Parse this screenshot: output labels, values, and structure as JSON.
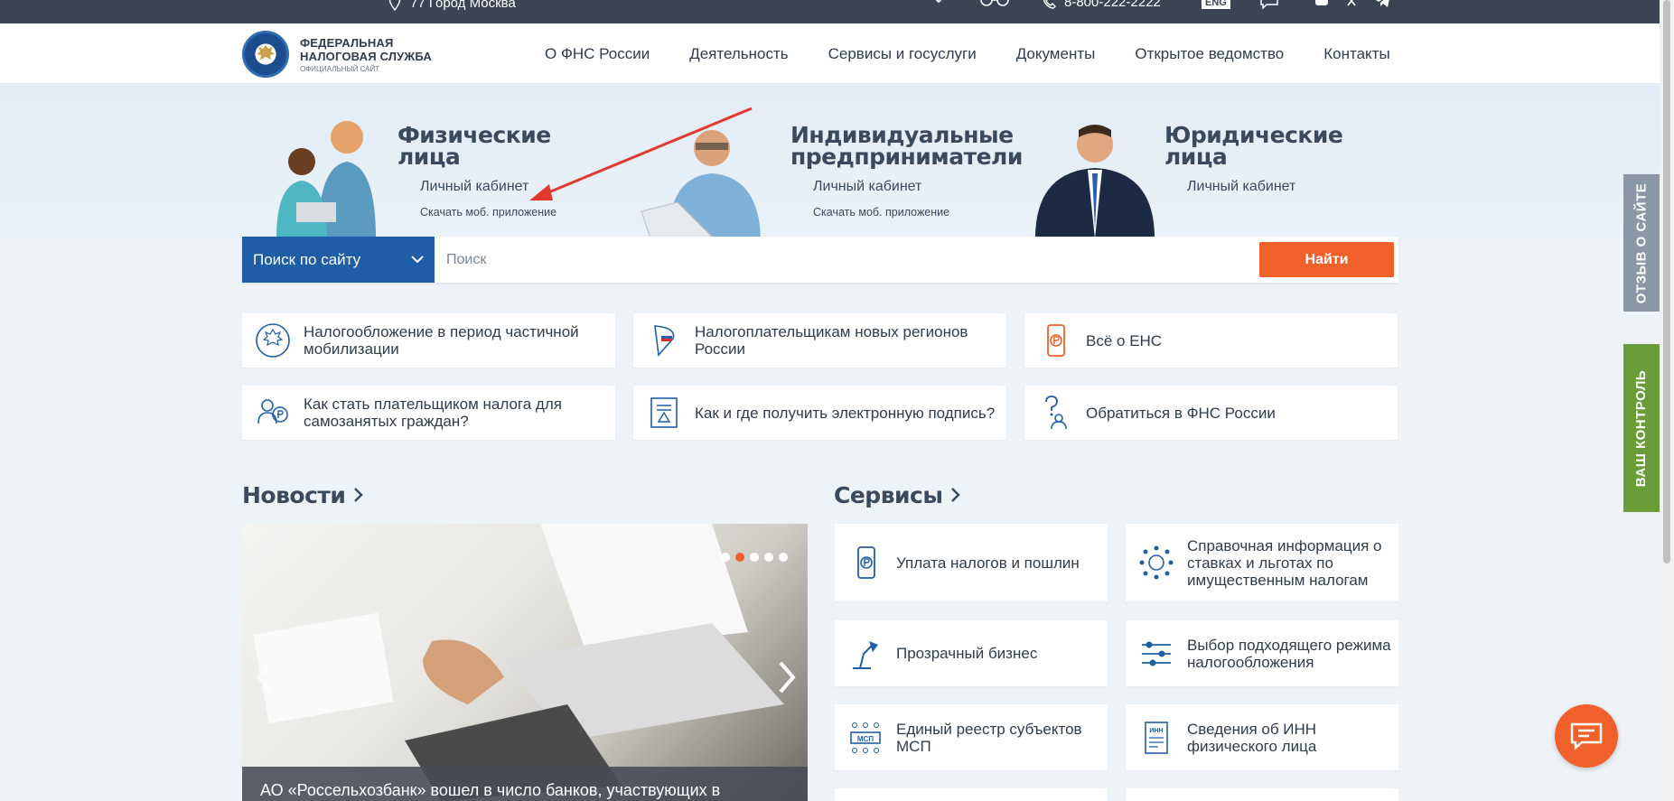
{
  "topbar": {
    "city": "77 Город Москва",
    "phone": "8-800-222-2222",
    "lang": "ENG"
  },
  "header": {
    "logo_line1": "ФЕДЕРАЛЬНАЯ",
    "logo_line2": "НАЛОГОВАЯ СЛУЖБА",
    "logo_line3": "ОФИЦИАЛЬНЫЙ САЙТ",
    "nav": [
      "О ФНС России",
      "Деятельность",
      "Сервисы и госуслуги",
      "Документы",
      "Открытое ведомство",
      "Контакты"
    ]
  },
  "hero": {
    "individuals": {
      "title1": "Физические",
      "title2": "лица",
      "cabinet": "Личный кабинет",
      "app": "Скачать моб. приложение"
    },
    "entrepreneurs": {
      "title1": "Индивидуальные",
      "title2": "предприниматели",
      "cabinet": "Личный кабинет",
      "app": "Скачать моб. приложение"
    },
    "legal": {
      "title1": "Юридические",
      "title2": "лица",
      "cabinet": "Личный кабинет"
    }
  },
  "search": {
    "scope": "Поиск по сайту",
    "placeholder": "Поиск",
    "button": "Найти"
  },
  "quick_links": [
    "Налогообложение в период частичной мобилизации",
    "Налогоплательщикам новых регионов России",
    "Всё о ЕНС",
    "Как стать плательщиком налога для самозанятых граждан?",
    "Как и где получить электронную подпись?",
    "Обратиться в ФНС России"
  ],
  "news": {
    "title": "Новости",
    "caption": "АО «Россельхозбанк» вошел в число банков, участвующих в"
  },
  "services": {
    "title": "Сервисы",
    "items": [
      "Уплата налогов и пошлин",
      "Справочная информация о ставках и льготах по имущественным налогам",
      "Прозрачный бизнес",
      "Выбор подходящего режима налогообложения",
      "Единый реестр субъектов МСП",
      "Сведения об ИНН физического лица"
    ]
  },
  "side": {
    "feedback": "ОТЗЫВ О САЙТЕ",
    "control": "ВАШ КОНТРОЛЬ"
  },
  "colors": {
    "accent": "#f0602a",
    "primary": "#1f5ea7",
    "topbar": "#3b4355"
  }
}
